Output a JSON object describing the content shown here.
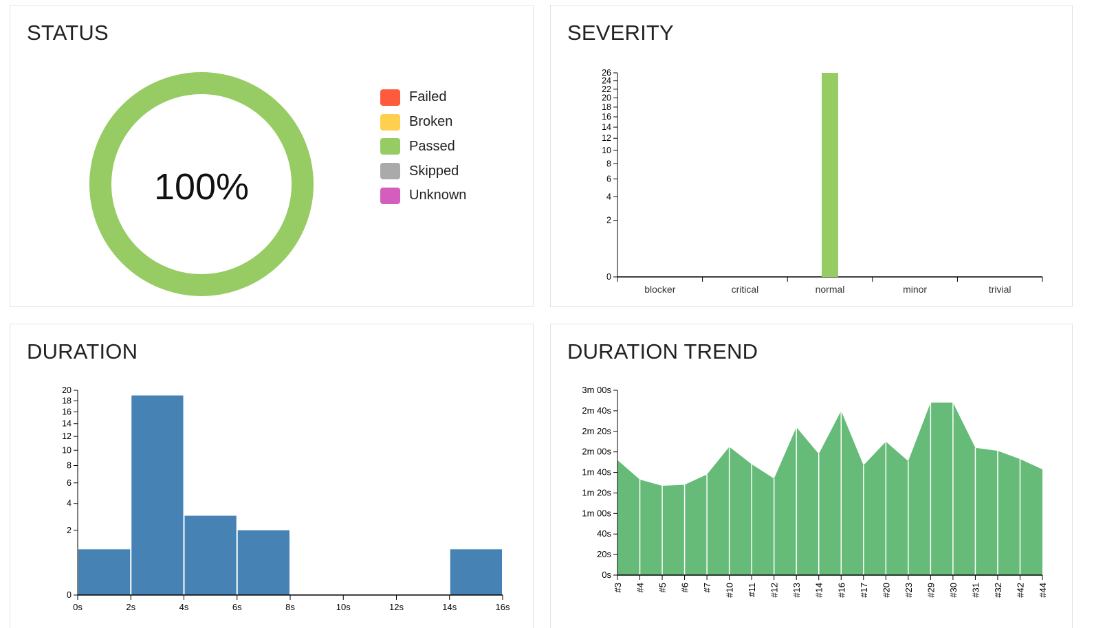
{
  "status": {
    "title": "STATUS",
    "center_label": "100%",
    "passed_fraction": 1.0,
    "legend": [
      {
        "label": "Failed",
        "color": "#fd5a3e"
      },
      {
        "label": "Broken",
        "color": "#ffd050"
      },
      {
        "label": "Passed",
        "color": "#97cc64"
      },
      {
        "label": "Skipped",
        "color": "#aaaaaa"
      },
      {
        "label": "Unknown",
        "color": "#d35ebe"
      }
    ]
  },
  "severity": {
    "title": "SEVERITY"
  },
  "duration": {
    "title": "DURATION"
  },
  "trend": {
    "title": "DURATION TREND"
  },
  "chart_data": [
    {
      "type": "pie",
      "categories": [
        "Failed",
        "Broken",
        "Passed",
        "Skipped",
        "Unknown"
      ],
      "values": [
        0,
        0,
        100,
        0,
        0
      ],
      "colors": [
        "#fd5a3e",
        "#ffd050",
        "#97cc64",
        "#aaaaaa",
        "#d35ebe"
      ],
      "center_label": "100%"
    },
    {
      "type": "bar",
      "categories": [
        "blocker",
        "critical",
        "normal",
        "minor",
        "trivial"
      ],
      "values": [
        0,
        0,
        26,
        0,
        0
      ],
      "color": "#97cc64",
      "yscale": "sqrt",
      "ylim": [
        0,
        26
      ],
      "yticks": [
        "0",
        "2",
        "4",
        "6",
        "8",
        "10",
        "12",
        "14",
        "16",
        "18",
        "20",
        "22",
        "24",
        "26"
      ],
      "ytick_values": [
        0,
        2,
        4,
        6,
        8,
        10,
        12,
        14,
        16,
        18,
        20,
        22,
        24,
        26
      ]
    },
    {
      "type": "bar",
      "bins": [
        [
          0,
          2
        ],
        [
          2,
          4
        ],
        [
          4,
          6
        ],
        [
          6,
          8
        ],
        [
          8,
          10
        ],
        [
          10,
          12
        ],
        [
          12,
          14
        ],
        [
          14,
          16
        ]
      ],
      "values": [
        1,
        19,
        3,
        2,
        0,
        0,
        0,
        1
      ],
      "color": "#4682b4",
      "xlim": [
        0,
        16
      ],
      "xticks": [
        "0s",
        "2s",
        "4s",
        "6s",
        "8s",
        "10s",
        "12s",
        "14s",
        "16s"
      ],
      "xtick_values": [
        0,
        2,
        4,
        6,
        8,
        10,
        12,
        14,
        16
      ],
      "yscale": "sqrt",
      "ylim": [
        0,
        20
      ],
      "yticks": [
        "0",
        "2",
        "4",
        "6",
        "8",
        "10",
        "12",
        "14",
        "16",
        "18",
        "20"
      ],
      "ytick_values": [
        0,
        2,
        4,
        6,
        8,
        10,
        12,
        14,
        16,
        18,
        20
      ]
    },
    {
      "type": "area",
      "x": [
        "#3",
        "#4",
        "#5",
        "#6",
        "#7",
        "#10",
        "#11",
        "#12",
        "#13",
        "#14",
        "#16",
        "#17",
        "#20",
        "#23",
        "#29",
        "#30",
        "#31",
        "#32",
        "#42",
        "#44"
      ],
      "values": [
        112,
        93,
        87,
        88,
        98,
        125,
        108,
        94,
        144,
        118,
        160,
        107,
        130,
        111,
        168,
        168,
        124,
        121,
        113,
        103
      ],
      "unit": "seconds",
      "color": "#4caf61",
      "ylim": [
        0,
        180
      ],
      "yticks": [
        "0s",
        "20s",
        "40s",
        "1m 00s",
        "1m 20s",
        "1m 40s",
        "2m 00s",
        "2m 20s",
        "2m 40s",
        "3m 00s"
      ],
      "ytick_values": [
        0,
        20,
        40,
        60,
        80,
        100,
        120,
        140,
        160,
        180
      ]
    }
  ]
}
